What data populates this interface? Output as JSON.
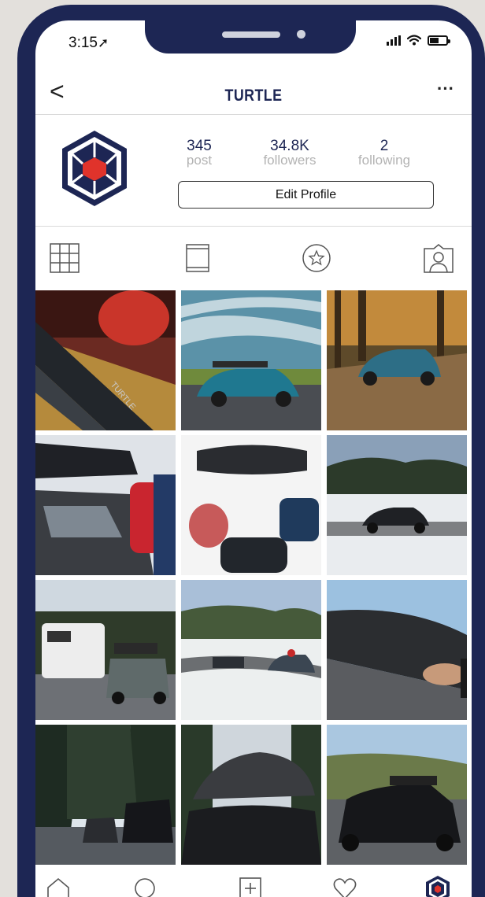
{
  "status_bar": {
    "time": "3:15",
    "location_arrow": "➚"
  },
  "header": {
    "back_glyph": "<",
    "title": "TURTLE",
    "more_glyph": "···"
  },
  "profile": {
    "avatar_icon": "turtle-hexagon-logo",
    "stats": [
      {
        "value": "345",
        "label": "post"
      },
      {
        "value": "34.8K",
        "label": "followers"
      },
      {
        "value": "2",
        "label": "following"
      }
    ],
    "edit_button": "Edit Profile"
  },
  "tabs": [
    {
      "icon": "grid-icon"
    },
    {
      "icon": "single-post-icon"
    },
    {
      "icon": "star-icon"
    },
    {
      "icon": "tagged-icon"
    }
  ],
  "posts": [
    {
      "subject": "roof rack bar close-up"
    },
    {
      "subject": "blue SUV with roof rack, cloudy sky"
    },
    {
      "subject": "blue SUV on forest road"
    },
    {
      "subject": "loading roof box on car"
    },
    {
      "subject": "roof box with bags"
    },
    {
      "subject": "black SUV in snowy landscape"
    },
    {
      "subject": "camper van and SUV"
    },
    {
      "subject": "cars on snowy mountain road"
    },
    {
      "subject": "hand opening roof box"
    },
    {
      "subject": "cars among pine trees"
    },
    {
      "subject": "roof box on car, trees"
    },
    {
      "subject": "black SUV on coastal road"
    }
  ],
  "bottom_nav": [
    {
      "icon": "home-icon"
    },
    {
      "icon": "search-icon"
    },
    {
      "icon": "add-post-icon"
    },
    {
      "icon": "heart-icon"
    },
    {
      "icon": "profile-logo-icon"
    }
  ],
  "colors": {
    "brand_navy": "#1d2654",
    "brand_red": "#e0332b",
    "background": "#e3e0dc"
  }
}
